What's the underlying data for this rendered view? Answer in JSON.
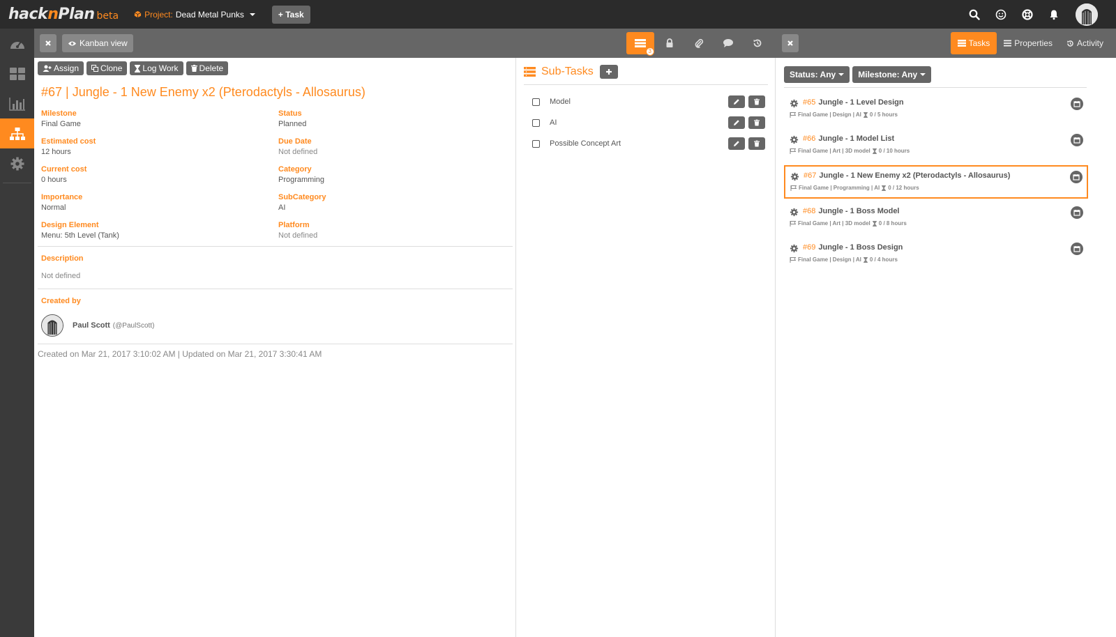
{
  "app": {
    "logo_main_a": "hack",
    "logo_main_n": "n",
    "logo_main_b": "Plan",
    "logo_beta": "beta"
  },
  "topbar": {
    "project_label": "Project:",
    "project_name": "Dead Metal Punks",
    "add_task_label": "+ Task"
  },
  "toolbar": {
    "kanban_label": "Kanban view",
    "subtasks_badge": "3",
    "tabs": {
      "tasks": "Tasks",
      "properties": "Properties",
      "activity": "Activity"
    }
  },
  "actions": {
    "assign": "Assign",
    "clone": "Clone",
    "log_work": "Log Work",
    "delete": "Delete"
  },
  "task": {
    "title": "#67 | Jungle - 1 New Enemy x2 (Pterodactyls - Allosaurus)",
    "props": {
      "milestone": {
        "label": "Milestone",
        "value": "Final Game"
      },
      "status": {
        "label": "Status",
        "value": "Planned"
      },
      "estimated": {
        "label": "Estimated cost",
        "value": "12 hours"
      },
      "due": {
        "label": "Due Date",
        "value": "Not defined"
      },
      "current": {
        "label": "Current cost",
        "value": "0 hours"
      },
      "category": {
        "label": "Category",
        "value": "Programming"
      },
      "importance": {
        "label": "Importance",
        "value": "Normal"
      },
      "subcategory": {
        "label": "SubCategory",
        "value": "AI"
      },
      "design": {
        "label": "Design Element",
        "value": "Menu: 5th Level (Tank)"
      },
      "platform": {
        "label": "Platform",
        "value": "Not defined"
      }
    },
    "description_label": "Description",
    "description_value": "Not defined",
    "created_by_label": "Created by",
    "creator_name": "Paul Scott",
    "creator_handle": "(@PaulScott)",
    "footer": "Created on Mar 21, 2017 3:10:02 AM | Updated on Mar 21, 2017 3:30:41 AM"
  },
  "subtasks": {
    "title": "Sub-Tasks",
    "items": [
      {
        "label": "Model"
      },
      {
        "label": "AI"
      },
      {
        "label": "Possible Concept Art"
      }
    ]
  },
  "filters": {
    "status": "Status: Any",
    "milestone": "Milestone: Any"
  },
  "tasks": [
    {
      "num": "#65",
      "title": "Jungle - 1 Level Design",
      "meta": "Final Game | Design | AI",
      "hours": "0 / 5 hours",
      "selected": false
    },
    {
      "num": "#66",
      "title": "Jungle - 1 Model List",
      "meta": "Final Game | Art | 3D model",
      "hours": "0 / 10 hours",
      "selected": false
    },
    {
      "num": "#67",
      "title": "Jungle - 1 New Enemy x2 (Pterodactyls - Allosaurus)",
      "meta": "Final Game | Programming | AI",
      "hours": "0 / 12 hours",
      "selected": true
    },
    {
      "num": "#68",
      "title": "Jungle - 1 Boss Model",
      "meta": "Final Game | Art | 3D model",
      "hours": "0 / 8 hours",
      "selected": false
    },
    {
      "num": "#69",
      "title": "Jungle - 1 Boss Design",
      "meta": "Final Game | Design | AI",
      "hours": "0 / 4 hours",
      "selected": false
    }
  ],
  "colors": {
    "accent": "#ff8a1f",
    "topbar": "#2b2b2b",
    "sidebar": "#3a3a3a",
    "toolbar": "#666666"
  }
}
